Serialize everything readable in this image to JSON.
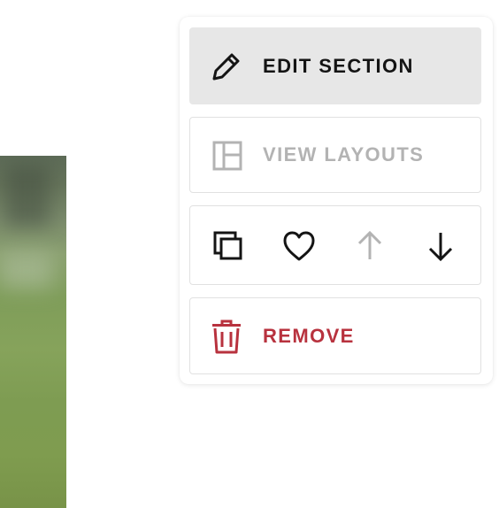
{
  "menu": {
    "edit_section_label": "EDIT SECTION",
    "view_layouts_label": "VIEW LAYOUTS",
    "remove_label": "REMOVE"
  },
  "icons": {
    "edit": "pencil-icon",
    "layouts": "layout-icon",
    "duplicate": "duplicate-icon",
    "favorite": "heart-icon",
    "move_up": "arrow-up-icon",
    "move_down": "arrow-down-icon",
    "remove": "trash-icon"
  },
  "states": {
    "view_layouts_disabled": true,
    "move_up_disabled": true
  },
  "colors": {
    "text_primary": "#141414",
    "text_disabled": "#b3b3b3",
    "danger": "#b8323e",
    "hover_background": "#e7e7e7",
    "border": "#e1e1e1"
  }
}
